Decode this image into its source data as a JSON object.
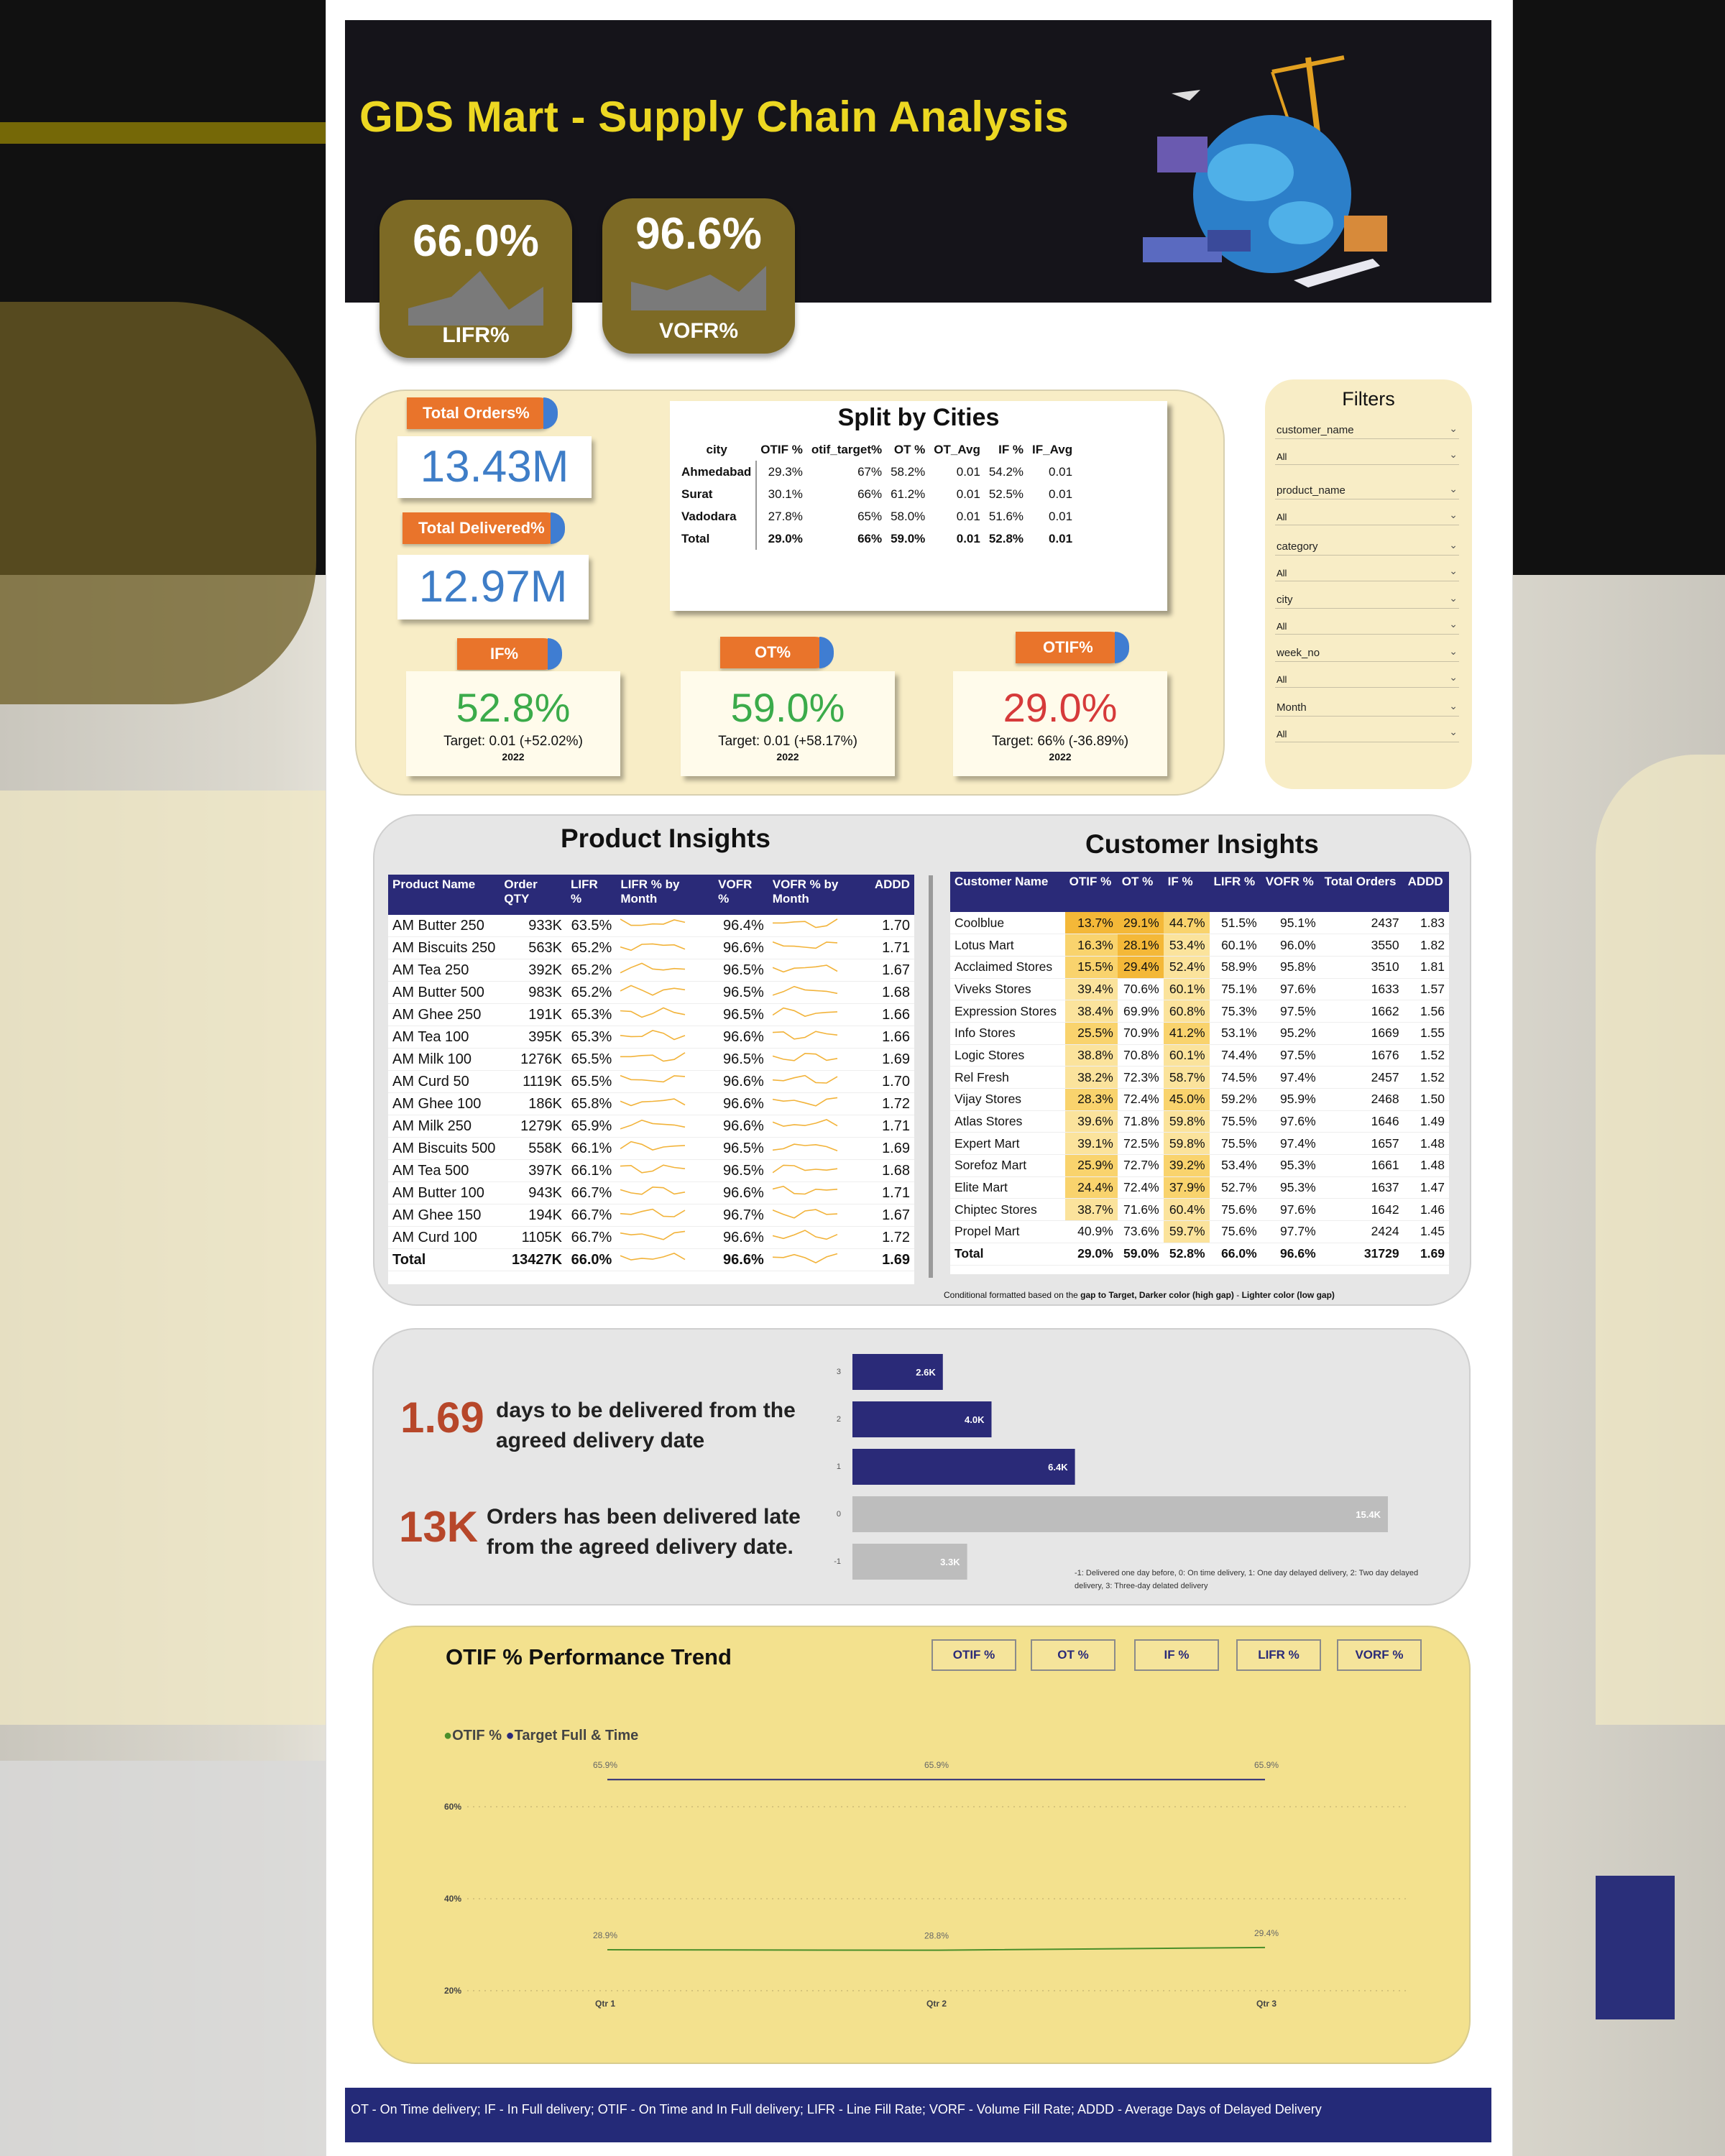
{
  "title": "GDS Mart - Supply Chain Analysis",
  "kpis": {
    "lifr": {
      "value": "66.0%",
      "label": "LIFR%"
    },
    "vofr": {
      "value": "96.6%",
      "label": "VOFR%"
    }
  },
  "totals": {
    "orders_label": "Total Orders%",
    "orders_value": "13.43M",
    "delivered_label": "Total Delivered%",
    "delivered_value": "12.97M"
  },
  "metrics": [
    {
      "label": "IF%",
      "value": "52.8%",
      "target": "Target: 0.01 (+52.02%)",
      "year": "2022",
      "color": "#3bab4a"
    },
    {
      "label": "OT%",
      "value": "59.0%",
      "target": "Target: 0.01 (+58.17%)",
      "year": "2022",
      "color": "#3bab4a"
    },
    {
      "label": "OTIF%",
      "value": "29.0%",
      "target": "Target: 66% (-36.89%)",
      "year": "2022",
      "color": "#d63a3a"
    }
  ],
  "cities": {
    "title": "Split by Cities",
    "columns": [
      "city",
      "OTIF %",
      "otif_target%",
      "OT %",
      "OT_Avg",
      "IF %",
      "IF_Avg"
    ],
    "rows": [
      [
        "Ahmedabad",
        "29.3%",
        "67%",
        "58.2%",
        "0.01",
        "54.2%",
        "0.01"
      ],
      [
        "Surat",
        "30.1%",
        "66%",
        "61.2%",
        "0.01",
        "52.5%",
        "0.01"
      ],
      [
        "Vadodara",
        "27.8%",
        "65%",
        "58.0%",
        "0.01",
        "51.6%",
        "0.01"
      ],
      [
        "Total",
        "29.0%",
        "66%",
        "59.0%",
        "0.01",
        "52.8%",
        "0.01"
      ]
    ]
  },
  "filters": {
    "title": "Filters",
    "items": [
      {
        "name": "customer_name",
        "value": "All"
      },
      {
        "name": "product_name",
        "value": "All"
      },
      {
        "name": "category",
        "value": "All"
      },
      {
        "name": "city",
        "value": "All"
      },
      {
        "name": "week_no",
        "value": "All"
      },
      {
        "name": "Month",
        "value": "All"
      }
    ]
  },
  "product_insights": {
    "title": "Product Insights",
    "columns": [
      "Product Name",
      "Order QTY",
      "LIFR %",
      "LIFR % by Month",
      "VOFR %",
      "VOFR % by Month",
      "ADDD"
    ],
    "rows": [
      [
        "AM Butter 250",
        "933K",
        "63.5%",
        "96.4%",
        "1.70"
      ],
      [
        "AM Biscuits 250",
        "563K",
        "65.2%",
        "96.6%",
        "1.71"
      ],
      [
        "AM Tea 250",
        "392K",
        "65.2%",
        "96.5%",
        "1.67"
      ],
      [
        "AM Butter 500",
        "983K",
        "65.2%",
        "96.5%",
        "1.68"
      ],
      [
        "AM Ghee 250",
        "191K",
        "65.3%",
        "96.5%",
        "1.66"
      ],
      [
        "AM Tea 100",
        "395K",
        "65.3%",
        "96.6%",
        "1.66"
      ],
      [
        "AM Milk 100",
        "1276K",
        "65.5%",
        "96.5%",
        "1.69"
      ],
      [
        "AM Curd 50",
        "1119K",
        "65.5%",
        "96.6%",
        "1.70"
      ],
      [
        "AM Ghee 100",
        "186K",
        "65.8%",
        "96.6%",
        "1.72"
      ],
      [
        "AM Milk 250",
        "1279K",
        "65.9%",
        "96.6%",
        "1.71"
      ],
      [
        "AM Biscuits 500",
        "558K",
        "66.1%",
        "96.5%",
        "1.69"
      ],
      [
        "AM Tea 500",
        "397K",
        "66.1%",
        "96.5%",
        "1.68"
      ],
      [
        "AM Butter 100",
        "943K",
        "66.7%",
        "96.6%",
        "1.71"
      ],
      [
        "AM Ghee 150",
        "194K",
        "66.7%",
        "96.7%",
        "1.67"
      ],
      [
        "AM Curd 100",
        "1105K",
        "66.7%",
        "96.6%",
        "1.72"
      ]
    ],
    "total": [
      "Total",
      "13427K",
      "66.0%",
      "96.6%",
      "1.69"
    ]
  },
  "customer_insights": {
    "title": "Customer Insights",
    "columns": [
      "Customer Name",
      "OTIF %",
      "OT %",
      "IF %",
      "LIFR %",
      "VOFR %",
      "Total Orders",
      "ADDD"
    ],
    "rows": [
      [
        "Coolblue",
        "13.7%",
        "29.1%",
        "44.7%",
        "51.5%",
        "95.1%",
        "2437",
        "1.83"
      ],
      [
        "Lotus Mart",
        "16.3%",
        "28.1%",
        "53.4%",
        "60.1%",
        "96.0%",
        "3550",
        "1.82"
      ],
      [
        "Acclaimed Stores",
        "15.5%",
        "29.4%",
        "52.4%",
        "58.9%",
        "95.8%",
        "3510",
        "1.81"
      ],
      [
        "Viveks Stores",
        "39.4%",
        "70.6%",
        "60.1%",
        "75.1%",
        "97.6%",
        "1633",
        "1.57"
      ],
      [
        "Expression Stores",
        "38.4%",
        "69.9%",
        "60.8%",
        "75.3%",
        "97.5%",
        "1662",
        "1.56"
      ],
      [
        "Info Stores",
        "25.5%",
        "70.9%",
        "41.2%",
        "53.1%",
        "95.2%",
        "1669",
        "1.55"
      ],
      [
        "Logic Stores",
        "38.8%",
        "70.8%",
        "60.1%",
        "74.4%",
        "97.5%",
        "1676",
        "1.52"
      ],
      [
        "Rel Fresh",
        "38.2%",
        "72.3%",
        "58.7%",
        "74.5%",
        "97.4%",
        "2457",
        "1.52"
      ],
      [
        "Vijay Stores",
        "28.3%",
        "72.4%",
        "45.0%",
        "59.2%",
        "95.9%",
        "2468",
        "1.50"
      ],
      [
        "Atlas Stores",
        "39.6%",
        "71.8%",
        "59.8%",
        "75.5%",
        "97.6%",
        "1646",
        "1.49"
      ],
      [
        "Expert Mart",
        "39.1%",
        "72.5%",
        "59.8%",
        "75.5%",
        "97.4%",
        "1657",
        "1.48"
      ],
      [
        "Sorefoz Mart",
        "25.9%",
        "72.7%",
        "39.2%",
        "53.4%",
        "95.3%",
        "1661",
        "1.48"
      ],
      [
        "Elite Mart",
        "24.4%",
        "72.4%",
        "37.9%",
        "52.7%",
        "95.3%",
        "1637",
        "1.47"
      ],
      [
        "Chiptec Stores",
        "38.7%",
        "71.6%",
        "60.4%",
        "75.6%",
        "97.6%",
        "1642",
        "1.46"
      ],
      [
        "Propel Mart",
        "40.9%",
        "73.6%",
        "59.7%",
        "75.6%",
        "97.7%",
        "2424",
        "1.45"
      ]
    ],
    "total": [
      "Total",
      "29.0%",
      "59.0%",
      "52.8%",
      "66.0%",
      "96.6%",
      "31729",
      "1.69"
    ],
    "note_prefix": "Conditional formatted based on the ",
    "note_bold1": "gap to Target, Darker color (high gap)",
    "note_mid": " - ",
    "note_bold2": "Lighter color (low gap)"
  },
  "delivery": {
    "days_value": "1.69",
    "days_text": "days to be delivered from the agreed delivery date",
    "late_value": "13K",
    "late_text": "Orders has been delivered late from the agreed delivery date.",
    "legend": "-1: Delivered one day before, 0: On time delivery, 1: One day delayed delivery, 2: Two day delayed delivery, 3: Three-day delated delivery"
  },
  "delay_chart": {
    "type": "bar",
    "categories": [
      "3",
      "2",
      "1",
      "0",
      "-1"
    ],
    "values": [
      2.6,
      4.0,
      6.4,
      15.4,
      3.3
    ],
    "labels": [
      "2.6K",
      "4.0K",
      "6.4K",
      "15.4K",
      "3.3K"
    ],
    "colors": [
      "#2a2a78",
      "#2a2a78",
      "#2a2a78",
      "#bdbdbd",
      "#bdbdbd"
    ],
    "xlim": [
      0,
      16
    ]
  },
  "trend": {
    "title": "OTIF % Performance Trend",
    "buttons": [
      "OTIF %",
      "OT %",
      "IF %",
      "LIFR %",
      "VORF %"
    ],
    "legend": [
      "OTIF %",
      "Target Full & Time"
    ],
    "legend_colors": [
      "#4a8f2a",
      "#2a2a78"
    ]
  },
  "chart_data": {
    "type": "line",
    "x": [
      "Qtr 1",
      "Qtr 2",
      "Qtr 3"
    ],
    "series": [
      {
        "name": "OTIF %",
        "values": [
          28.9,
          28.8,
          29.4
        ],
        "color": "#4a8f2a"
      },
      {
        "name": "Target Full & Time",
        "values": [
          65.9,
          65.9,
          65.9
        ],
        "color": "#2a2a78"
      }
    ],
    "value_labels": [
      [
        "28.9%",
        "28.8%",
        "29.4%"
      ],
      [
        "65.9%",
        "65.9%",
        "65.9%"
      ]
    ],
    "y_ticks": [
      "20%",
      "40%",
      "60%"
    ],
    "ylim": [
      20,
      70
    ]
  },
  "footer": "OT - On Time delivery; IF - In Full delivery; OTIF - On Time and In Full delivery; LIFR - Line Fill Rate; VORF - Volume Fill Rate; ADDD - Average Days of Delayed Delivery"
}
